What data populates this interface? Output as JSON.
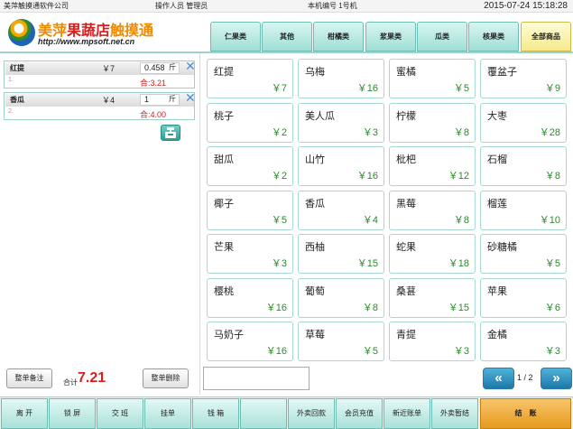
{
  "topbar": {
    "company": "美萍触摸通软件公司",
    "operator": "操作人员 管理员",
    "machine": "本机编号 1号机",
    "datetime": "2015-07-24 15:18:28"
  },
  "logo": {
    "title_a": "美萍",
    "title_b": "果蔬店",
    "title_c": "触摸通",
    "url": "http://www.mpsoft.net.cn"
  },
  "tabs": [
    "仁果类",
    "其他",
    "柑橘类",
    "浆果类",
    "瓜类",
    "核果类",
    "全部商品"
  ],
  "active_tab": "全部商品",
  "orders": [
    {
      "index": "1.",
      "name": "红提",
      "price": "￥7",
      "qty": "0.458",
      "unit": "斤",
      "sum": "合:3.21"
    },
    {
      "index": "2.",
      "name": "香瓜",
      "price": "￥4",
      "qty": "1",
      "unit": "斤",
      "sum": "合:4.00"
    }
  ],
  "left_footer": {
    "note_button": "整单备注",
    "total_label": "合计",
    "total_value": "7.21",
    "delete_button": "整单删除"
  },
  "products": [
    {
      "name": "红提",
      "price": "￥7"
    },
    {
      "name": "乌梅",
      "price": "￥16"
    },
    {
      "name": "蜜橘",
      "price": "￥5"
    },
    {
      "name": "覆盆子",
      "price": "￥9"
    },
    {
      "name": "桃子",
      "price": "￥2"
    },
    {
      "name": "美人瓜",
      "price": "￥3"
    },
    {
      "name": "柠檬",
      "price": "￥8"
    },
    {
      "name": "大枣",
      "price": "￥28"
    },
    {
      "name": "甜瓜",
      "price": "￥2"
    },
    {
      "name": "山竹",
      "price": "￥16"
    },
    {
      "name": "枇杷",
      "price": "￥12"
    },
    {
      "name": "石榴",
      "price": "￥8"
    },
    {
      "name": "椰子",
      "price": "￥5"
    },
    {
      "name": "香瓜",
      "price": "￥4"
    },
    {
      "name": "黑莓",
      "price": "￥8"
    },
    {
      "name": "榴莲",
      "price": "￥10"
    },
    {
      "name": "芒果",
      "price": "￥3"
    },
    {
      "name": "西柚",
      "price": "￥15"
    },
    {
      "name": "蛇果",
      "price": "￥18"
    },
    {
      "name": "砂糖橘",
      "price": "￥5"
    },
    {
      "name": "樱桃",
      "price": "￥16"
    },
    {
      "name": "葡萄",
      "price": "￥8"
    },
    {
      "name": "桑葚",
      "price": "￥15"
    },
    {
      "name": "苹果",
      "price": "￥6"
    },
    {
      "name": "马奶子",
      "price": "￥16"
    },
    {
      "name": "草莓",
      "price": "￥5"
    },
    {
      "name": "青提",
      "price": "￥3"
    },
    {
      "name": "金橘",
      "price": "￥3"
    }
  ],
  "pager": {
    "text": "1 / 2",
    "prev_icon": "double-chevron-left-icon",
    "next_icon": "double-chevron-right-icon"
  },
  "bottom_buttons": [
    "离 开",
    "锁 屏",
    "交 班",
    "挂单",
    "钱 箱",
    "",
    "外卖回款",
    "会员充值",
    "新近账单",
    "外卖暂结",
    "结　账"
  ],
  "colors": {
    "accent": "#9fdfd6",
    "price": "#2c8a2c",
    "total": "#d62020",
    "pay": "#e69a1e"
  }
}
